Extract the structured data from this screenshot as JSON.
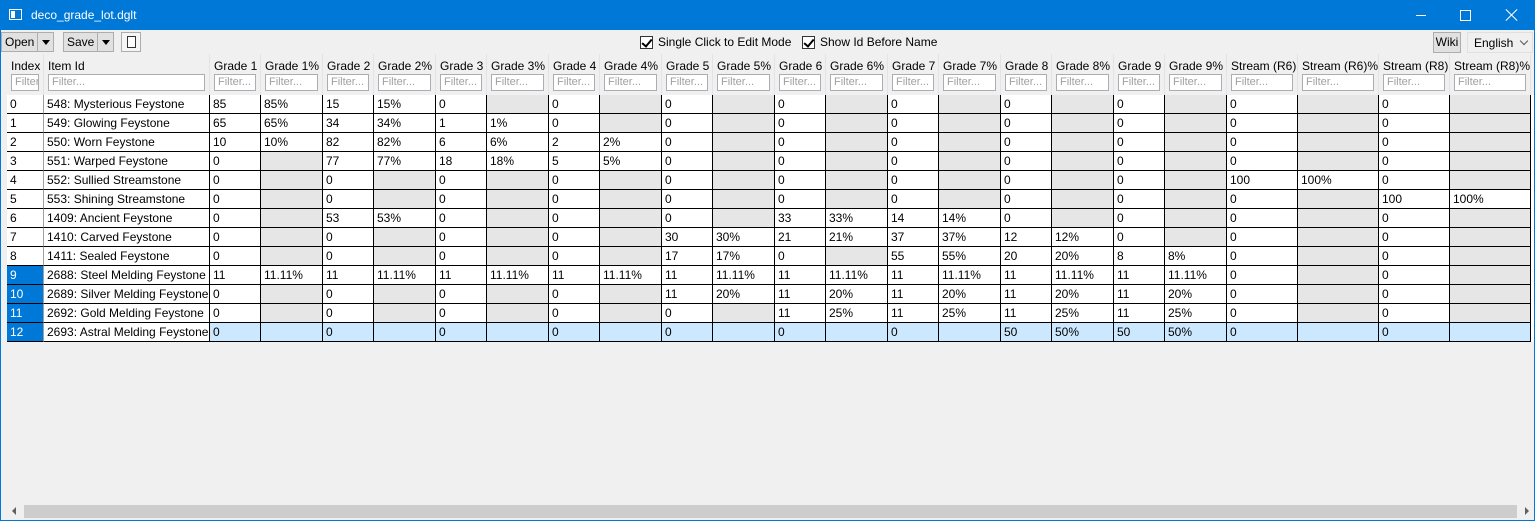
{
  "window": {
    "title": "deco_grade_lot.dglt"
  },
  "toolbar": {
    "open_label": "Open",
    "save_label": "Save",
    "single_click_label": "Single Click to Edit Mode",
    "single_click_checked": true,
    "show_id_label": "Show Id Before Name",
    "show_id_checked": true,
    "wiki_label": "Wiki",
    "language_selected": "English"
  },
  "table": {
    "filter_placeholder": "Filter...",
    "columns": [
      "Index",
      "Item Id",
      "Grade 1",
      "Grade 1%",
      "Grade 2",
      "Grade 2%",
      "Grade 3",
      "Grade 3%",
      "Grade 4",
      "Grade 4%",
      "Grade 5",
      "Grade 5%",
      "Grade 6",
      "Grade 6%",
      "Grade 7",
      "Grade 7%",
      "Grade 8",
      "Grade 8%",
      "Grade 9",
      "Grade 9%",
      "Stream (R6)",
      "Stream (R6)%",
      "Stream (R8)",
      "Stream (R8)%"
    ],
    "selected_rows": [
      9,
      10,
      11,
      12
    ],
    "current_row": 12,
    "rows": [
      [
        "0",
        "548: Mysterious Feystone",
        "85",
        "85%",
        "15",
        "15%",
        "0",
        "",
        "0",
        "",
        "0",
        "",
        "0",
        "",
        "0",
        "",
        "0",
        "",
        "0",
        "",
        "0",
        "",
        "0",
        ""
      ],
      [
        "1",
        "549: Glowing Feystone",
        "65",
        "65%",
        "34",
        "34%",
        "1",
        "1%",
        "0",
        "",
        "0",
        "",
        "0",
        "",
        "0",
        "",
        "0",
        "",
        "0",
        "",
        "0",
        "",
        "0",
        ""
      ],
      [
        "2",
        "550: Worn Feystone",
        "10",
        "10%",
        "82",
        "82%",
        "6",
        "6%",
        "2",
        "2%",
        "0",
        "",
        "0",
        "",
        "0",
        "",
        "0",
        "",
        "0",
        "",
        "0",
        "",
        "0",
        ""
      ],
      [
        "3",
        "551: Warped Feystone",
        "0",
        "",
        "77",
        "77%",
        "18",
        "18%",
        "5",
        "5%",
        "0",
        "",
        "0",
        "",
        "0",
        "",
        "0",
        "",
        "0",
        "",
        "0",
        "",
        "0",
        ""
      ],
      [
        "4",
        "552: Sullied Streamstone",
        "0",
        "",
        "0",
        "",
        "0",
        "",
        "0",
        "",
        "0",
        "",
        "0",
        "",
        "0",
        "",
        "0",
        "",
        "0",
        "",
        "100",
        "100%",
        "0",
        ""
      ],
      [
        "5",
        "553: Shining Streamstone",
        "0",
        "",
        "0",
        "",
        "0",
        "",
        "0",
        "",
        "0",
        "",
        "0",
        "",
        "0",
        "",
        "0",
        "",
        "0",
        "",
        "0",
        "",
        "100",
        "100%"
      ],
      [
        "6",
        "1409: Ancient Feystone",
        "0",
        "",
        "53",
        "53%",
        "0",
        "",
        "0",
        "",
        "0",
        "",
        "33",
        "33%",
        "14",
        "14%",
        "0",
        "",
        "0",
        "",
        "0",
        "",
        "0",
        ""
      ],
      [
        "7",
        "1410: Carved Feystone",
        "0",
        "",
        "0",
        "",
        "0",
        "",
        "0",
        "",
        "30",
        "30%",
        "21",
        "21%",
        "37",
        "37%",
        "12",
        "12%",
        "0",
        "",
        "0",
        "",
        "0",
        ""
      ],
      [
        "8",
        "1411: Sealed Feystone",
        "0",
        "",
        "0",
        "",
        "0",
        "",
        "0",
        "",
        "17",
        "17%",
        "0",
        "",
        "55",
        "55%",
        "20",
        "20%",
        "8",
        "8%",
        "0",
        "",
        "0",
        ""
      ],
      [
        "9",
        "2688: Steel Melding Feystone",
        "11",
        "11.11%",
        "11",
        "11.11%",
        "11",
        "11.11%",
        "11",
        "11.11%",
        "11",
        "11.11%",
        "11",
        "11.11%",
        "11",
        "11.11%",
        "11",
        "11.11%",
        "11",
        "11.11%",
        "0",
        "",
        "0",
        ""
      ],
      [
        "10",
        "2689: Silver Melding Feystone",
        "0",
        "",
        "0",
        "",
        "0",
        "",
        "0",
        "",
        "11",
        "20%",
        "11",
        "20%",
        "11",
        "20%",
        "11",
        "20%",
        "11",
        "20%",
        "0",
        "",
        "0",
        ""
      ],
      [
        "11",
        "2692: Gold Melding Feystone",
        "0",
        "",
        "0",
        "",
        "0",
        "",
        "0",
        "",
        "0",
        "",
        "11",
        "25%",
        "11",
        "25%",
        "11",
        "25%",
        "11",
        "25%",
        "0",
        "",
        "0",
        ""
      ],
      [
        "12",
        "2693: Astral Melding Feystone",
        "0",
        "",
        "0",
        "",
        "0",
        "",
        "0",
        "",
        "0",
        "",
        "0",
        "",
        "0",
        "",
        "50",
        "50%",
        "50",
        "50%",
        "0",
        "",
        "0",
        ""
      ]
    ]
  }
}
